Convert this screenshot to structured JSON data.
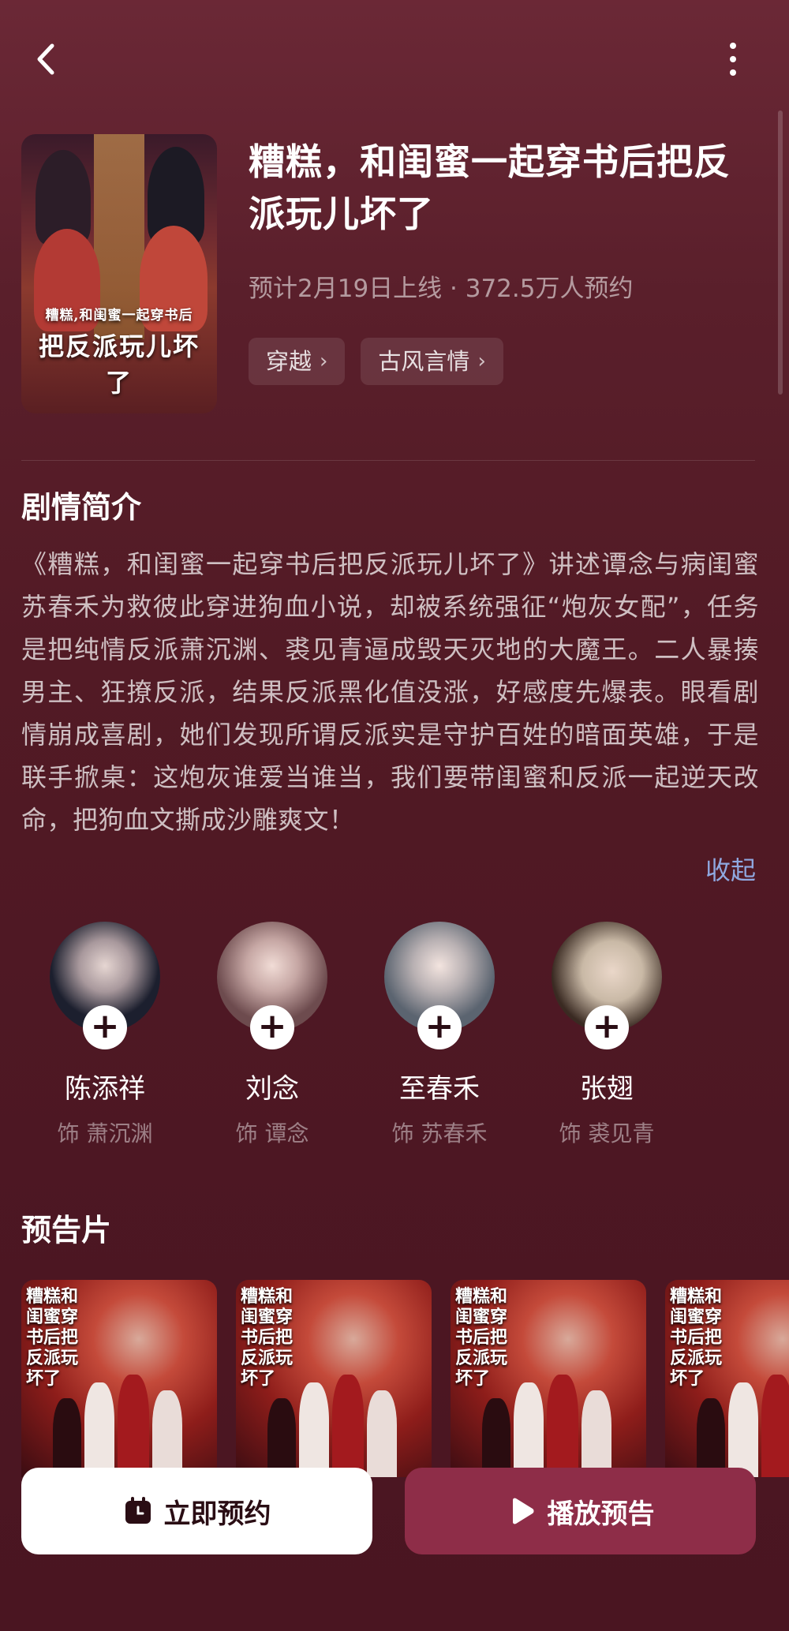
{
  "header": {
    "back_icon": "chevron-left-icon",
    "more_icon": "more-vertical-icon"
  },
  "drama": {
    "title": "糟糕，和闺蜜一起穿书后把反派玩儿坏了",
    "poster_art_line1": "糟糕,和闺蜜一起穿书后",
    "poster_art_line2": "把反派玩儿坏了",
    "meta": "预计2月19日上线 · 372.5万人预约",
    "tags": [
      {
        "label": "穿越"
      },
      {
        "label": "古风言情"
      }
    ]
  },
  "synopsis": {
    "heading": "剧情简介",
    "text": "《糟糕，和闺蜜一起穿书后把反派玩儿坏了》讲述谭念与病闺蜜苏春禾为救彼此穿进狗血小说，却被系统强征“炮灰女配”，任务是把纯情反派萧沉渊、裘见青逼成毁天灭地的大魔王。二人暴揍男主、狂撩反派，结果反派黑化值没涨，好感度先爆表。眼看剧情崩成喜剧，她们发现所谓反派实是守护百姓的暗面英雄，于是联手掀桌：这炮灰谁爱当谁当，我们要带闺蜜和反派一起逆天改命，把狗血文撕成沙雕爽文！",
    "collapse_label": "收起"
  },
  "cast": [
    {
      "name": "陈添祥",
      "role": "饰 萧沉渊",
      "follow": "+",
      "color": "#1c1f2e"
    },
    {
      "name": "刘念",
      "role": "饰 谭念",
      "follow": "+",
      "color": "#6d4b4e"
    },
    {
      "name": "至春禾",
      "role": "饰 苏春禾",
      "follow": "+",
      "color": "#5b6470"
    },
    {
      "name": "张翅",
      "role": "饰 裘见青",
      "follow": "+",
      "color": "#c9b9a6"
    }
  ],
  "trailers": {
    "heading": "预告片",
    "items": [
      {
        "art_text": "糟糕和闺蜜穿书后把反派玩坏了"
      },
      {
        "art_text": "糟糕和闺蜜穿书后把反派玩坏了"
      },
      {
        "art_text": "糟糕和闺蜜穿书后把反派玩坏了"
      },
      {
        "art_text": "糟糕和闺蜜穿书后把反派玩坏了"
      }
    ]
  },
  "actions": {
    "reserve_label": "立即预约",
    "reserve_icon": "calendar-clock-icon",
    "play_label": "播放预告",
    "play_icon": "play-icon"
  }
}
